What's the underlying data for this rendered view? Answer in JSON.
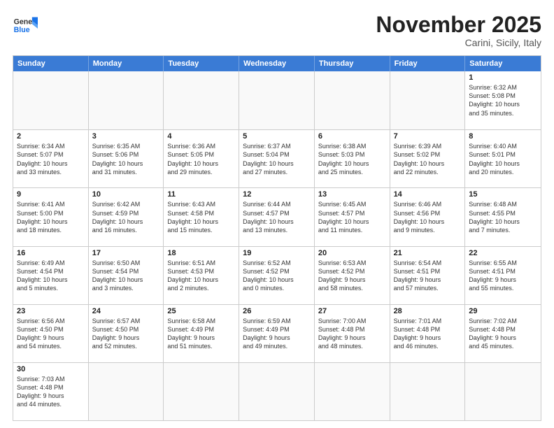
{
  "header": {
    "logo_general": "General",
    "logo_blue": "Blue",
    "month": "November 2025",
    "location": "Carini, Sicily, Italy"
  },
  "weekdays": [
    "Sunday",
    "Monday",
    "Tuesday",
    "Wednesday",
    "Thursday",
    "Friday",
    "Saturday"
  ],
  "weeks": [
    [
      {
        "day": "",
        "info": ""
      },
      {
        "day": "",
        "info": ""
      },
      {
        "day": "",
        "info": ""
      },
      {
        "day": "",
        "info": ""
      },
      {
        "day": "",
        "info": ""
      },
      {
        "day": "",
        "info": ""
      },
      {
        "day": "1",
        "info": "Sunrise: 6:32 AM\nSunset: 5:08 PM\nDaylight: 10 hours\nand 35 minutes."
      }
    ],
    [
      {
        "day": "2",
        "info": "Sunrise: 6:34 AM\nSunset: 5:07 PM\nDaylight: 10 hours\nand 33 minutes."
      },
      {
        "day": "3",
        "info": "Sunrise: 6:35 AM\nSunset: 5:06 PM\nDaylight: 10 hours\nand 31 minutes."
      },
      {
        "day": "4",
        "info": "Sunrise: 6:36 AM\nSunset: 5:05 PM\nDaylight: 10 hours\nand 29 minutes."
      },
      {
        "day": "5",
        "info": "Sunrise: 6:37 AM\nSunset: 5:04 PM\nDaylight: 10 hours\nand 27 minutes."
      },
      {
        "day": "6",
        "info": "Sunrise: 6:38 AM\nSunset: 5:03 PM\nDaylight: 10 hours\nand 25 minutes."
      },
      {
        "day": "7",
        "info": "Sunrise: 6:39 AM\nSunset: 5:02 PM\nDaylight: 10 hours\nand 22 minutes."
      },
      {
        "day": "8",
        "info": "Sunrise: 6:40 AM\nSunset: 5:01 PM\nDaylight: 10 hours\nand 20 minutes."
      }
    ],
    [
      {
        "day": "9",
        "info": "Sunrise: 6:41 AM\nSunset: 5:00 PM\nDaylight: 10 hours\nand 18 minutes."
      },
      {
        "day": "10",
        "info": "Sunrise: 6:42 AM\nSunset: 4:59 PM\nDaylight: 10 hours\nand 16 minutes."
      },
      {
        "day": "11",
        "info": "Sunrise: 6:43 AM\nSunset: 4:58 PM\nDaylight: 10 hours\nand 15 minutes."
      },
      {
        "day": "12",
        "info": "Sunrise: 6:44 AM\nSunset: 4:57 PM\nDaylight: 10 hours\nand 13 minutes."
      },
      {
        "day": "13",
        "info": "Sunrise: 6:45 AM\nSunset: 4:57 PM\nDaylight: 10 hours\nand 11 minutes."
      },
      {
        "day": "14",
        "info": "Sunrise: 6:46 AM\nSunset: 4:56 PM\nDaylight: 10 hours\nand 9 minutes."
      },
      {
        "day": "15",
        "info": "Sunrise: 6:48 AM\nSunset: 4:55 PM\nDaylight: 10 hours\nand 7 minutes."
      }
    ],
    [
      {
        "day": "16",
        "info": "Sunrise: 6:49 AM\nSunset: 4:54 PM\nDaylight: 10 hours\nand 5 minutes."
      },
      {
        "day": "17",
        "info": "Sunrise: 6:50 AM\nSunset: 4:54 PM\nDaylight: 10 hours\nand 3 minutes."
      },
      {
        "day": "18",
        "info": "Sunrise: 6:51 AM\nSunset: 4:53 PM\nDaylight: 10 hours\nand 2 minutes."
      },
      {
        "day": "19",
        "info": "Sunrise: 6:52 AM\nSunset: 4:52 PM\nDaylight: 10 hours\nand 0 minutes."
      },
      {
        "day": "20",
        "info": "Sunrise: 6:53 AM\nSunset: 4:52 PM\nDaylight: 9 hours\nand 58 minutes."
      },
      {
        "day": "21",
        "info": "Sunrise: 6:54 AM\nSunset: 4:51 PM\nDaylight: 9 hours\nand 57 minutes."
      },
      {
        "day": "22",
        "info": "Sunrise: 6:55 AM\nSunset: 4:51 PM\nDaylight: 9 hours\nand 55 minutes."
      }
    ],
    [
      {
        "day": "23",
        "info": "Sunrise: 6:56 AM\nSunset: 4:50 PM\nDaylight: 9 hours\nand 54 minutes."
      },
      {
        "day": "24",
        "info": "Sunrise: 6:57 AM\nSunset: 4:50 PM\nDaylight: 9 hours\nand 52 minutes."
      },
      {
        "day": "25",
        "info": "Sunrise: 6:58 AM\nSunset: 4:49 PM\nDaylight: 9 hours\nand 51 minutes."
      },
      {
        "day": "26",
        "info": "Sunrise: 6:59 AM\nSunset: 4:49 PM\nDaylight: 9 hours\nand 49 minutes."
      },
      {
        "day": "27",
        "info": "Sunrise: 7:00 AM\nSunset: 4:48 PM\nDaylight: 9 hours\nand 48 minutes."
      },
      {
        "day": "28",
        "info": "Sunrise: 7:01 AM\nSunset: 4:48 PM\nDaylight: 9 hours\nand 46 minutes."
      },
      {
        "day": "29",
        "info": "Sunrise: 7:02 AM\nSunset: 4:48 PM\nDaylight: 9 hours\nand 45 minutes."
      }
    ],
    [
      {
        "day": "30",
        "info": "Sunrise: 7:03 AM\nSunset: 4:48 PM\nDaylight: 9 hours\nand 44 minutes."
      },
      {
        "day": "",
        "info": ""
      },
      {
        "day": "",
        "info": ""
      },
      {
        "day": "",
        "info": ""
      },
      {
        "day": "",
        "info": ""
      },
      {
        "day": "",
        "info": ""
      },
      {
        "day": "",
        "info": ""
      }
    ]
  ]
}
